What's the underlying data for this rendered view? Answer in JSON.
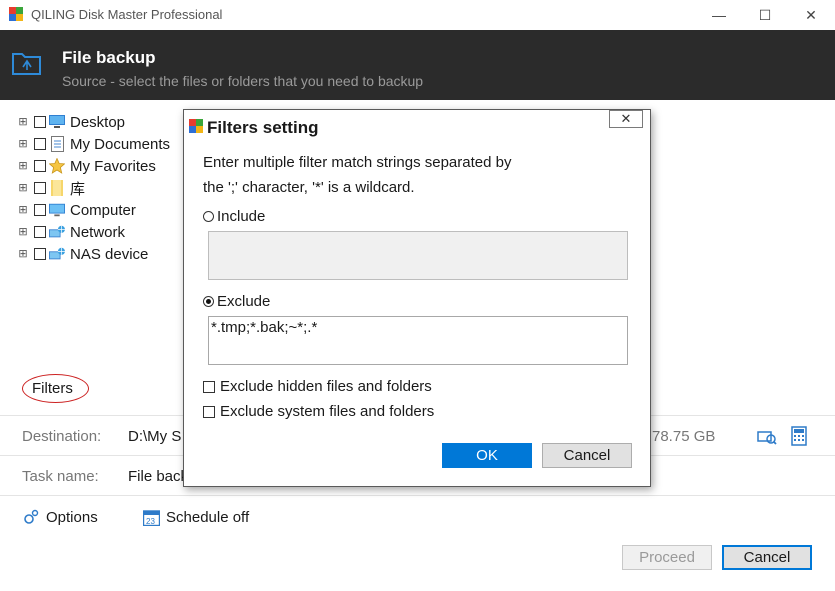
{
  "window": {
    "title": "QILING Disk Master Professional",
    "min_glyph": "—",
    "max_glyph": "☐",
    "close_glyph": "✕"
  },
  "header": {
    "title": "File backup",
    "subtitle": "Source - select the files or folders that you need to backup",
    "icon": "folder-backup-icon"
  },
  "tree": {
    "items": [
      {
        "label": "Desktop",
        "icon": "desktop-icon"
      },
      {
        "label": "My Documents",
        "icon": "documents-icon"
      },
      {
        "label": "My Favorites",
        "icon": "star-icon"
      },
      {
        "label": "库",
        "icon": "folder-icon"
      },
      {
        "label": "Computer",
        "icon": "computer-icon"
      },
      {
        "label": "Network",
        "icon": "network-icon"
      },
      {
        "label": "NAS device",
        "icon": "nas-icon"
      }
    ],
    "expander_glyph": "⊞"
  },
  "filters_link": "Filters",
  "destination": {
    "label": "Destination:",
    "value": "D:\\My S",
    "free_space": "78.75 GB"
  },
  "task": {
    "label": "Task name:",
    "value": "File back"
  },
  "options": {
    "options_label": "Options",
    "schedule_label": "Schedule off"
  },
  "footer": {
    "proceed": "Proceed",
    "cancel": "Cancel"
  },
  "dialog": {
    "title": "Filters setting",
    "close_glyph": "✕",
    "instruction_line1": "Enter multiple filter match strings separated by",
    "instruction_line2": "the ';' character, '*' is a wildcard.",
    "include_label": "Include",
    "include_value": "",
    "exclude_label": "Exclude",
    "exclude_value": "*.tmp;*.bak;~*;.*",
    "selected_mode": "exclude",
    "exclude_hidden_label": "Exclude hidden files and folders",
    "exclude_system_label": "Exclude system files and folders",
    "ok": "OK",
    "cancel": "Cancel"
  },
  "colors": {
    "header_bg": "#2b2b2b",
    "accent": "#0078d7",
    "filters_ellipse": "#cc2222"
  }
}
